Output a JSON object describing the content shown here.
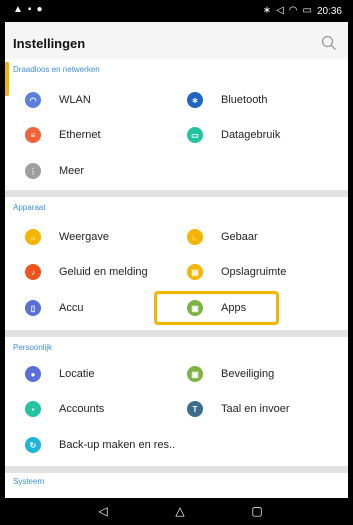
{
  "statusbar": {
    "time": "20:36"
  },
  "appbar": {
    "title": "Instellingen"
  },
  "sections": {
    "wireless": {
      "header": "Draadloos en netwerken",
      "items": [
        {
          "label": "WLAN",
          "color": "#5b7fde",
          "icon": "wifi-icon"
        },
        {
          "label": "Bluetooth",
          "color": "#1e66c2",
          "icon": "bluetooth-icon"
        },
        {
          "label": "Ethernet",
          "color": "#f0643c",
          "icon": "ethernet-icon"
        },
        {
          "label": "Datagebruik",
          "color": "#22c4a0",
          "icon": "data-usage-icon"
        },
        {
          "label": "Meer",
          "color": "#9e9e9e",
          "icon": "more-icon"
        }
      ]
    },
    "device": {
      "header": "Apparaat",
      "items": [
        {
          "label": "Weergave",
          "color": "#f5b400",
          "icon": "display-icon"
        },
        {
          "label": "Gebaar",
          "color": "#f5b400",
          "icon": "gesture-icon"
        },
        {
          "label": "Geluid en melding",
          "color": "#f0541e",
          "icon": "sound-icon"
        },
        {
          "label": "Opslagruimte",
          "color": "#f5b400",
          "icon": "storage-icon"
        },
        {
          "label": "Accu",
          "color": "#5b6fd8",
          "icon": "battery-icon"
        },
        {
          "label": "Apps",
          "color": "#7cb342",
          "icon": "apps-icon"
        }
      ]
    },
    "personal": {
      "header": "Persoonlijk",
      "items": [
        {
          "label": "Locatie",
          "color": "#5b6fd8",
          "icon": "location-icon"
        },
        {
          "label": "Beveiliging",
          "color": "#7cb342",
          "icon": "security-icon"
        },
        {
          "label": "Accounts",
          "color": "#22c4a0",
          "icon": "accounts-icon"
        },
        {
          "label": "Taal en invoer",
          "color": "#3d6d8c",
          "icon": "language-icon"
        },
        {
          "label": "Back-up maken en res..",
          "color": "#22b4d8",
          "icon": "backup-icon"
        }
      ]
    },
    "system": {
      "header": "Systeem"
    }
  },
  "colors": {
    "accent": "#3f8fe8",
    "highlight": "#f5b400"
  }
}
